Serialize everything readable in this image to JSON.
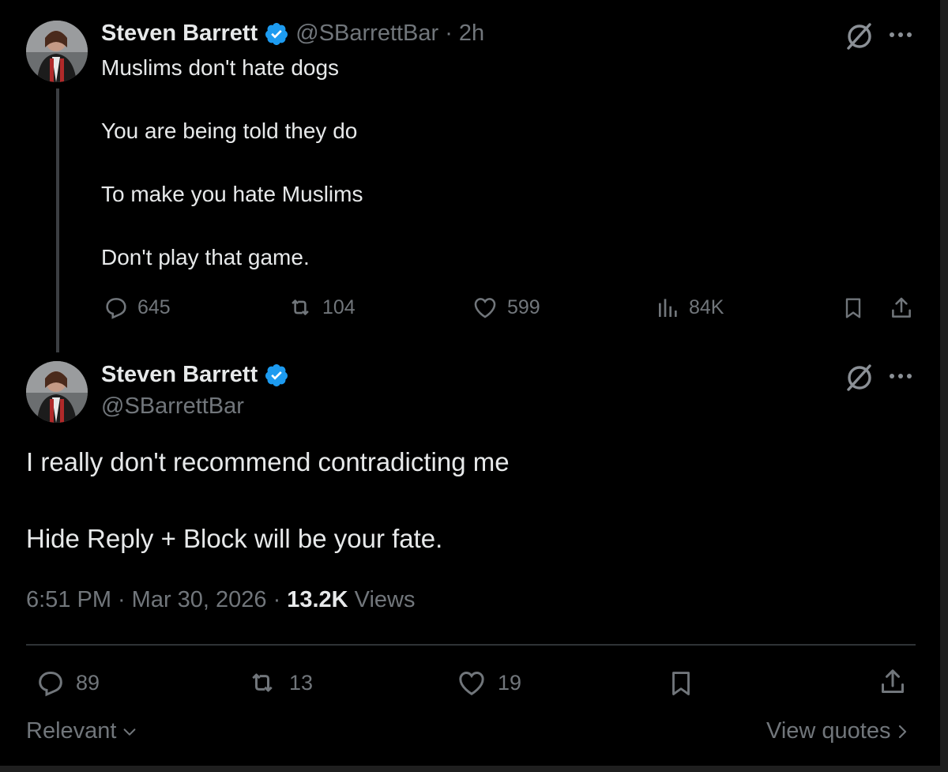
{
  "colors": {
    "background": "#000000",
    "text": "#e7e9ea",
    "muted": "#71767b",
    "verified": "#1d9bf0",
    "divider": "#2f3336"
  },
  "tweet1": {
    "name": "Steven Barrett",
    "handle": "@SBarrettBar",
    "separator": "·",
    "time": "2h",
    "lines": [
      "Muslims don't hate dogs",
      "You are being told they do",
      "To make you hate Muslims",
      "Don't play that game."
    ],
    "replies": "645",
    "reposts": "104",
    "likes": "599",
    "views": "84K"
  },
  "tweet2": {
    "name": "Steven Barrett",
    "handle": "@SBarrettBar",
    "lines": [
      "I really don't recommend contradicting me",
      "Hide Reply + Block will be your fate."
    ],
    "time": "6:51 PM",
    "date": "Mar 30, 2026",
    "views_count": "13.2K",
    "views_label": "Views",
    "sep": "·",
    "replies": "89",
    "reposts": "13",
    "likes": "19"
  },
  "footer": {
    "sort_label": "Relevant",
    "view_quotes": "View quotes"
  },
  "icons": {
    "grok": "grok-icon",
    "more": "more-icon",
    "reply": "reply-icon",
    "repost": "repost-icon",
    "like": "heart-icon",
    "views": "views-icon",
    "bookmark": "bookmark-icon",
    "share": "share-icon",
    "verified": "verified-badge-icon"
  }
}
